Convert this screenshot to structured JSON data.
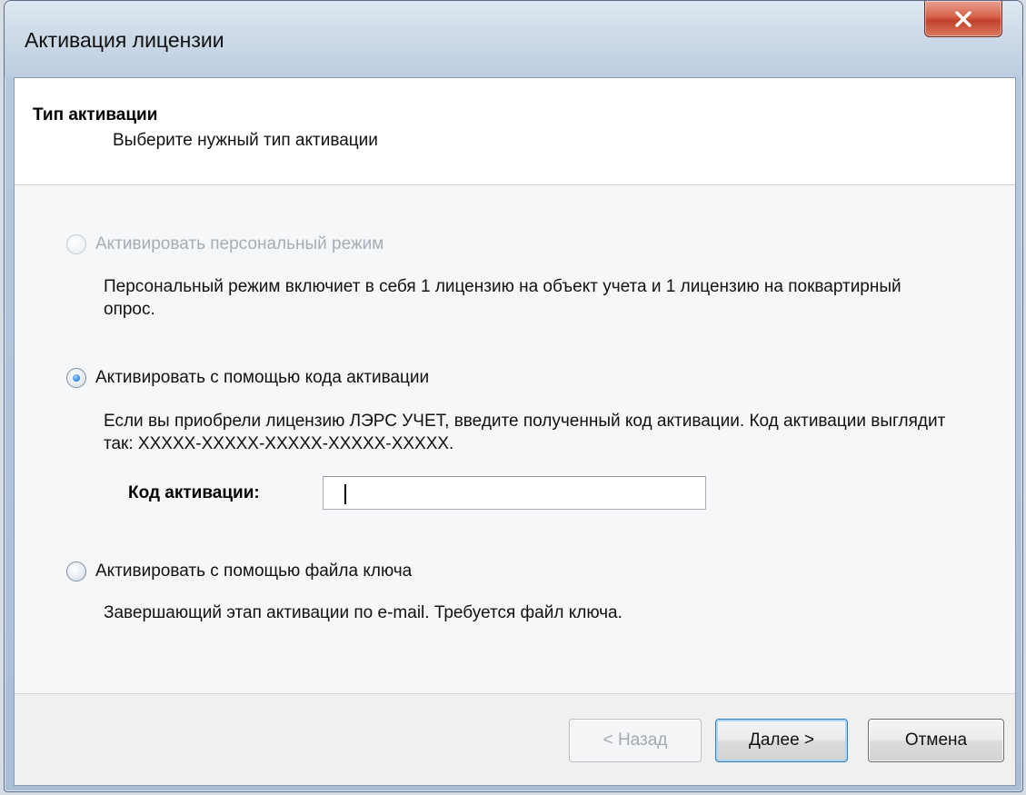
{
  "window": {
    "title": "Активация лицензии"
  },
  "header": {
    "title": "Тип активации",
    "subtitle": "Выберите нужный тип активации"
  },
  "options": [
    {
      "label": "Активировать персональный режим",
      "description": "Персональный режим включиет в себя 1 лицензию на объект учета и 1 лицензию на поквартирный опрос.",
      "state": "disabled"
    },
    {
      "label": "Активировать с помощью кода активации",
      "description": "Если вы приобрели лицензию ЛЭРС УЧЕТ, введите полученный код активации. Код активации выглядит так: XXXXX-XXXXX-XXXXX-XXXXX-XXXXX.",
      "state": "selected"
    },
    {
      "label": "Активировать с помощью файла ключа",
      "description": "Завершающий этап активации по e-mail. Требуется файл ключа.",
      "state": "unselected"
    }
  ],
  "activation_code": {
    "label": "Код активации:",
    "value": ""
  },
  "footer": {
    "back_label": "< Назад",
    "next_label": "Далее >",
    "cancel_label": "Отмена"
  },
  "colors": {
    "close_button": "#c3402b",
    "disabled_text": "#a4adb6",
    "radio_selected": "#3a8ee0"
  }
}
